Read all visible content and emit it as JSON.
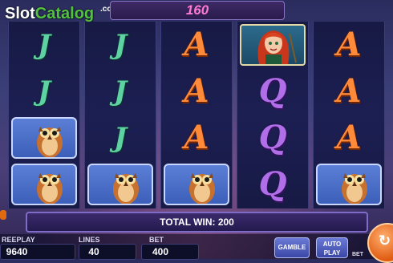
{
  "watermark": {
    "brand_part1": "Slot",
    "brand_part2": "Catalog",
    "suffix": ".com"
  },
  "top_win": {
    "value": "160"
  },
  "reels": [
    [
      "J",
      "J",
      "owl",
      "owl"
    ],
    [
      "J",
      "J",
      "J",
      "owl"
    ],
    [
      "A",
      "A",
      "A",
      "owl"
    ],
    [
      "witch",
      "Q",
      "Q",
      "Q"
    ],
    [
      "A",
      "A",
      "A",
      "owl"
    ]
  ],
  "total_win": {
    "text": "TOTAL WIN: 200"
  },
  "stats": {
    "freeplay_label": "REEPLAY",
    "freeplay_value": "9640",
    "lines_label": "LINES",
    "lines_value": "40",
    "bet_label": "BET",
    "bet_value": "400"
  },
  "buttons": {
    "gamble": "GAMBLE",
    "autoplay_line1": "AUTO",
    "autoplay_line2": "PLAY",
    "bet_small": "BET"
  },
  "colors": {
    "J": "#5fd2a4",
    "A": "#ff8a3a",
    "Q": "#b06ee8",
    "accent": "#ff7ad0"
  }
}
